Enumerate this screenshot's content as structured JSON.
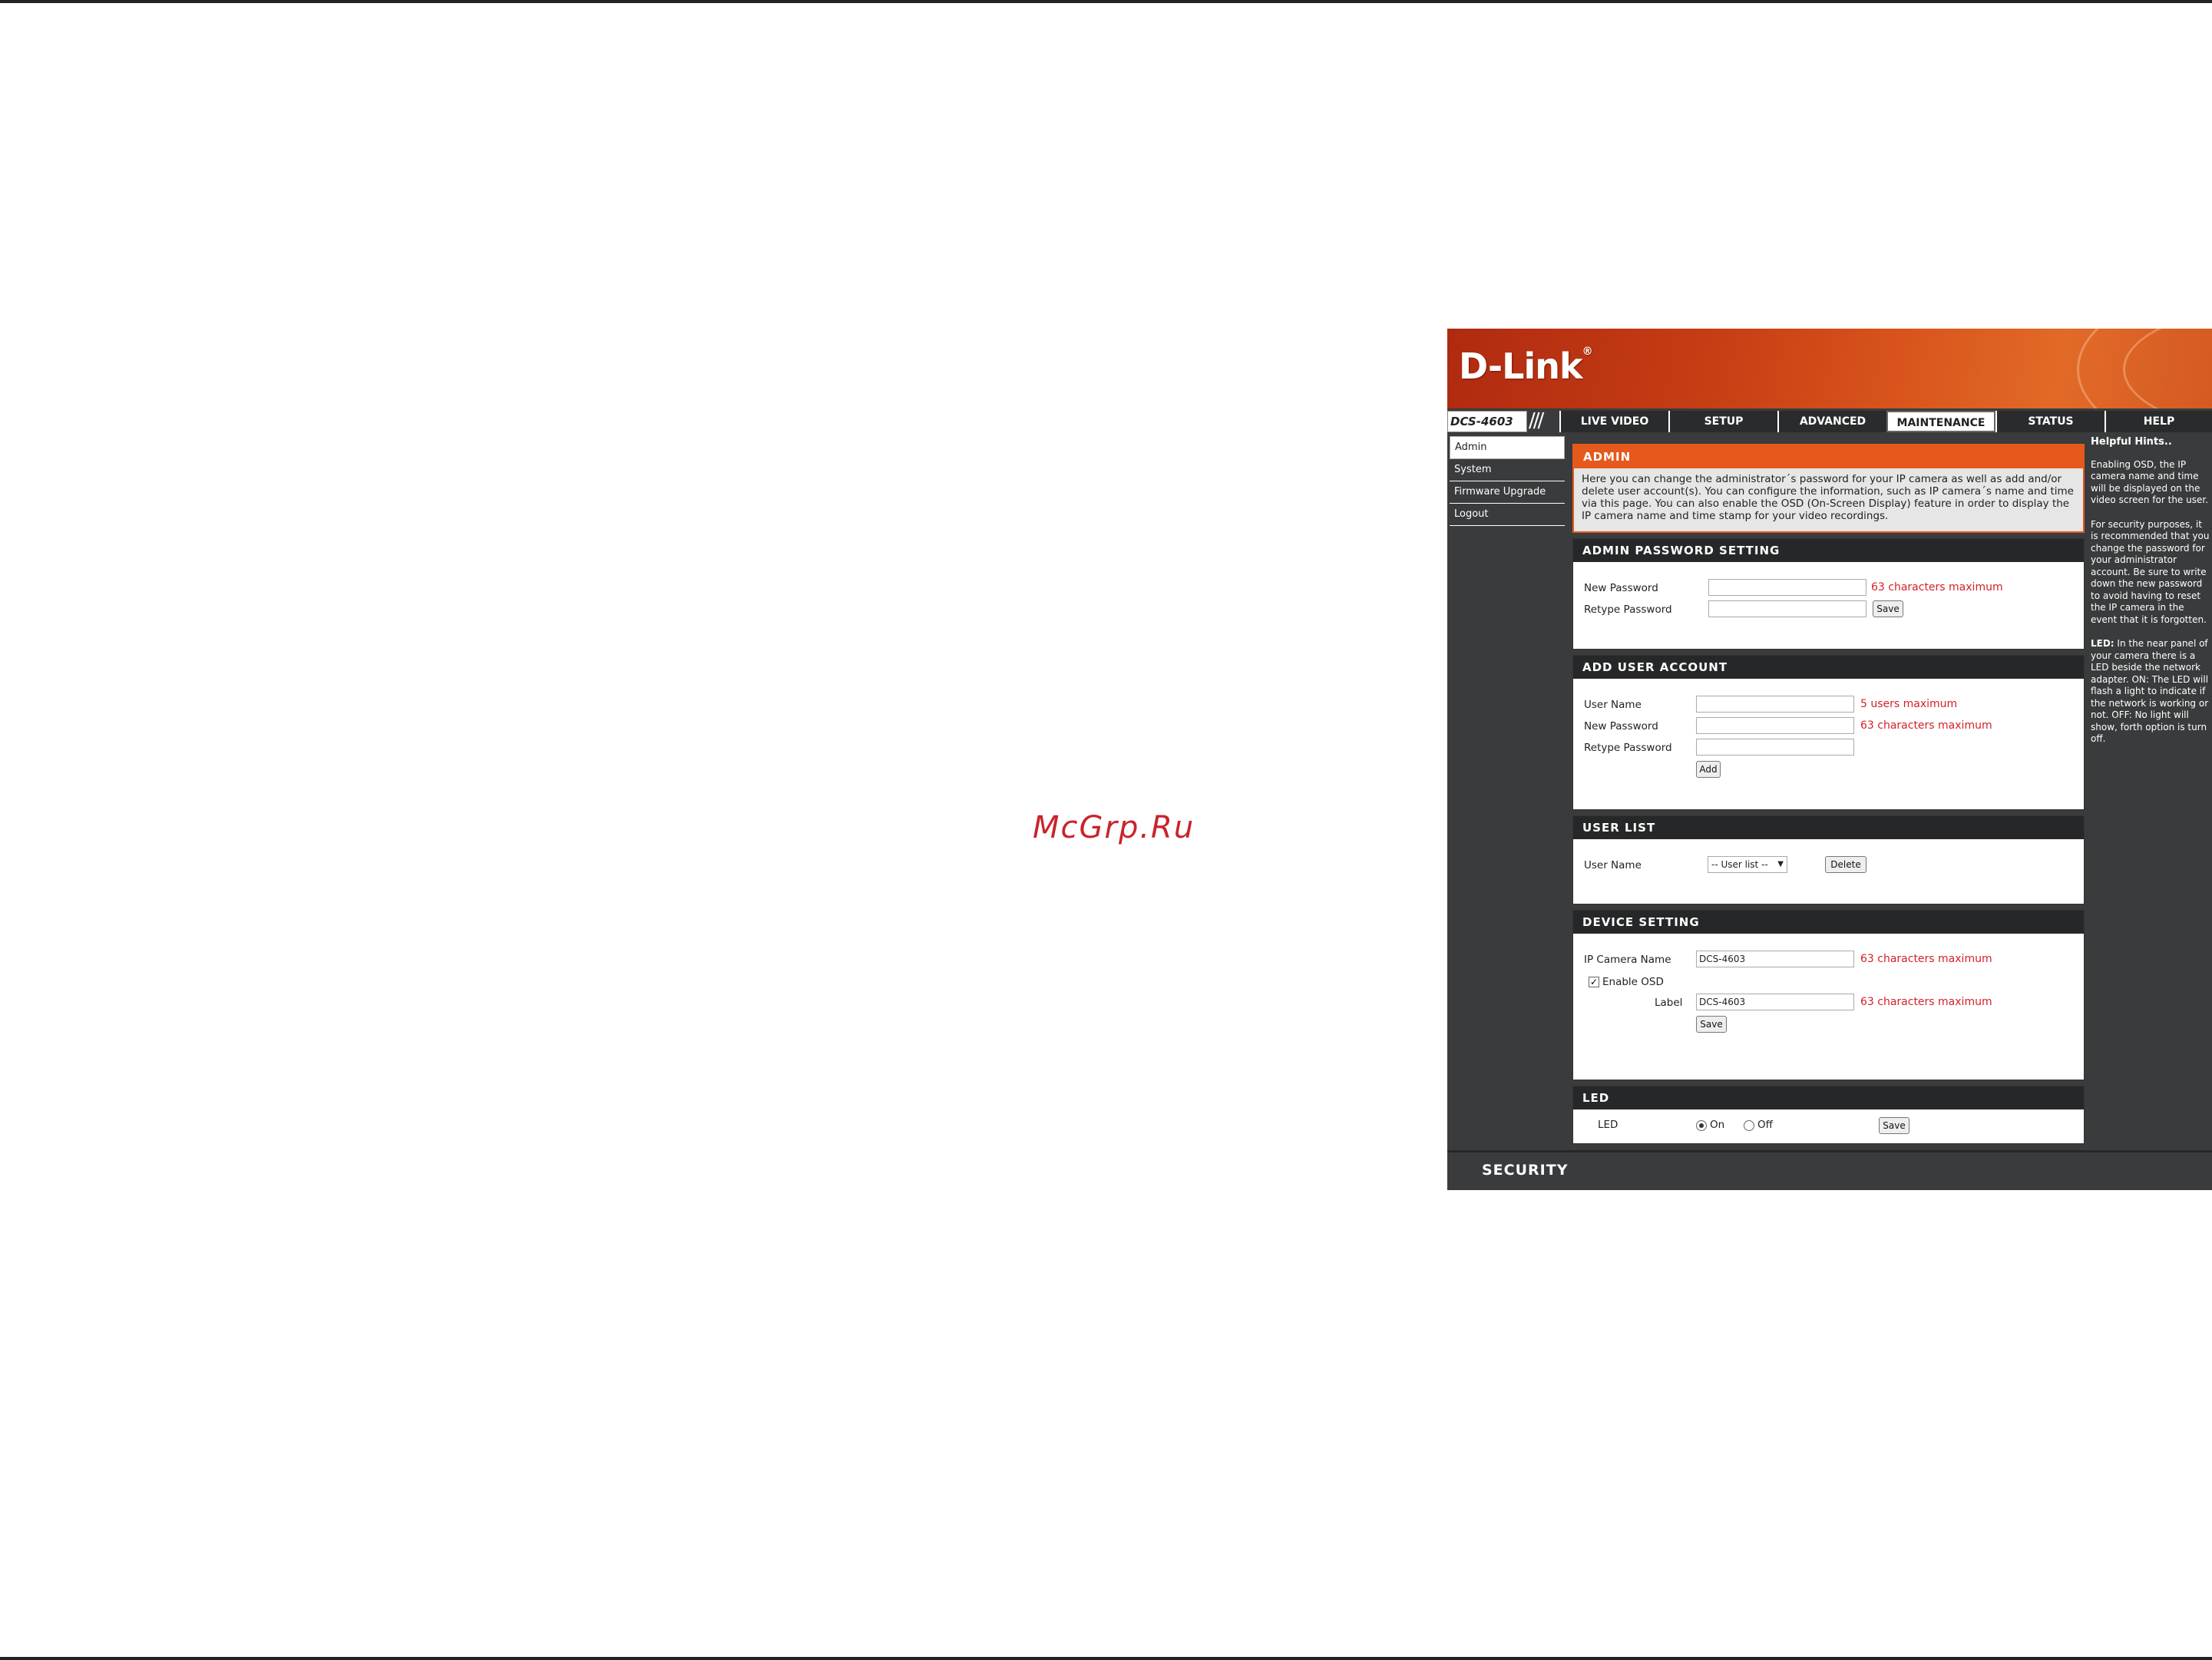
{
  "watermark": "McGrp.Ru",
  "brand": {
    "logo": "D-Link",
    "model": "DCS-4603"
  },
  "nav": {
    "tabs": [
      "LIVE VIDEO",
      "SETUP",
      "ADVANCED",
      "MAINTENANCE",
      "STATUS",
      "HELP"
    ],
    "active_tab": "MAINTENANCE"
  },
  "sidebar": {
    "items": [
      "Admin",
      "System",
      "Firmware Upgrade",
      "Logout"
    ],
    "active": "Admin"
  },
  "admin": {
    "title": "ADMIN",
    "description": "Here you can change the administrator´s password for your IP camera as well as add and/or delete user account(s). You can configure the information, such as IP camera´s name and time via this page. You can also enable the OSD (On-Screen Display) feature in order to display the IP camera name and time stamp for your video recordings."
  },
  "admin_password": {
    "title": "ADMIN PASSWORD SETTING",
    "new_password_label": "New Password",
    "retype_password_label": "Retype Password",
    "new_password_value": "",
    "retype_password_value": "",
    "max_hint": "63 characters maximum",
    "save_label": "Save"
  },
  "add_user": {
    "title": "ADD USER ACCOUNT",
    "user_name_label": "User Name",
    "new_password_label": "New Password",
    "retype_password_label": "Retype Password",
    "user_name_hint": "5 users maximum",
    "password_hint": "63 characters maximum",
    "add_label": "Add"
  },
  "user_list": {
    "title": "USER LIST",
    "user_name_label": "User Name",
    "select_value": "-- User list --",
    "delete_label": "Delete"
  },
  "device_setting": {
    "title": "DEVICE SETTING",
    "camera_name_label": "IP Camera Name",
    "camera_name_value": "DCS-4603",
    "camera_name_hint": "63 characters maximum",
    "enable_osd_label": "Enable OSD",
    "enable_osd_checked": true,
    "label_label": "Label",
    "label_value": "DCS-4603",
    "label_hint": "63 characters maximum",
    "save_label": "Save"
  },
  "led": {
    "title": "LED",
    "led_label": "LED",
    "on_label": "On",
    "off_label": "Off",
    "selected": "On",
    "save_label": "Save"
  },
  "hints": {
    "title": "Helpful Hints..",
    "p1": "Enabling OSD, the IP camera name and time will be displayed on the video screen for the user.",
    "p2": "For security purposes, it is recommended that you change the password for your administrator account. Be sure to write down the new password to avoid having to reset the IP camera in the event that it is forgotten.",
    "p3_bold": "LED:",
    "p3": " In the near panel of your camera there is a LED beside the network adapter. ON: The LED will flash a light to indicate if the network is working or not. OFF: No light will show, forth option is turn off."
  },
  "footer": {
    "label": "SECURITY"
  },
  "colors": {
    "accent": "#e5591c",
    "hint_red": "#d4202a",
    "panel_dark": "#3a3b3c"
  }
}
